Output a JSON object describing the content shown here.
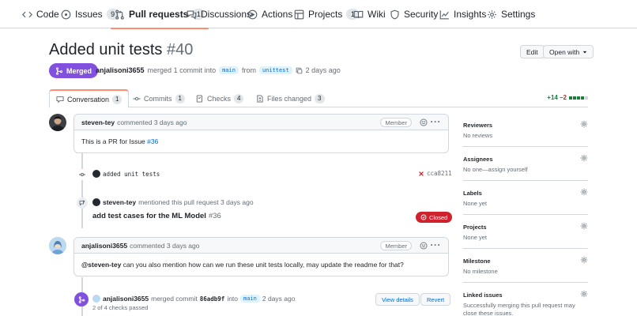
{
  "repo_nav": {
    "tabs": [
      {
        "label": "Code",
        "icon": "code-icon"
      },
      {
        "label": "Issues",
        "count": "9",
        "icon": "issue-opened-icon"
      },
      {
        "label": "Pull requests",
        "count": "1",
        "icon": "git-pull-request-icon",
        "selected": true
      },
      {
        "label": "Discussions",
        "icon": "comment-discussion-icon"
      },
      {
        "label": "Actions",
        "icon": "play-icon"
      },
      {
        "label": "Projects",
        "count": "1",
        "icon": "table-icon"
      },
      {
        "label": "Wiki",
        "icon": "book-icon"
      },
      {
        "label": "Security",
        "icon": "shield-icon"
      },
      {
        "label": "Insights",
        "icon": "graph-icon"
      },
      {
        "label": "Settings",
        "icon": "gear-icon"
      }
    ]
  },
  "header": {
    "title": "Added unit tests",
    "number": "#40",
    "edit_label": "Edit",
    "open_with_label": "Open with",
    "state_label": "Merged",
    "author": "anjalisoni3655",
    "merged_text": "merged 1 commit into",
    "base_branch": "main",
    "from_text": "from",
    "head_branch": "unittest",
    "time": "2 days ago"
  },
  "pr_tabs": {
    "conversation": {
      "label": "Conversation",
      "count": "1"
    },
    "commits": {
      "label": "Commits",
      "count": "1"
    },
    "checks": {
      "label": "Checks",
      "count": "4"
    },
    "files": {
      "label": "Files changed",
      "count": "3"
    },
    "additions": "+14",
    "deletions": "−2"
  },
  "timeline": {
    "comment1": {
      "author": "steven-tey",
      "meta": "commented 3 days ago",
      "role": "Member",
      "body_prefix": "This is a PR for Issue ",
      "body_link": "#36"
    },
    "commit": {
      "message": "added unit tests",
      "status_icon": "x-icon",
      "sha": "cca8211"
    },
    "mention": {
      "author": "steven-tey",
      "text": "mentioned this pull request 3 days ago",
      "issue_title": "add test cases for the ML Model",
      "issue_number": "#36",
      "state_label": "Closed"
    },
    "comment2": {
      "author": "anjalisoni3655",
      "meta": "commented 3 days ago",
      "role": "Member",
      "body_mention": "@steven-tey",
      "body_text": " can you also mention how can we run these unit tests locally, may update the readme for that?"
    },
    "merge": {
      "author": "anjalisoni3655",
      "text": "merged commit",
      "sha": "86adb9f",
      "into_text": "into",
      "branch": "main",
      "time": "2 days ago",
      "checks": "2 of 4 checks passed",
      "view_details_label": "View details",
      "revert_label": "Revert"
    }
  },
  "sidebar": {
    "reviewers": {
      "title": "Reviewers",
      "value": "No reviews"
    },
    "assignees": {
      "title": "Assignees",
      "value": "No one—assign yourself"
    },
    "labels": {
      "title": "Labels",
      "value": "None yet"
    },
    "projects": {
      "title": "Projects",
      "value": "None yet"
    },
    "milestone": {
      "title": "Milestone",
      "value": "No milestone"
    },
    "linked": {
      "title": "Linked issues",
      "value": "Successfully merging this pull request may close these issues."
    }
  },
  "colors": {
    "merged": "#8250df",
    "closed": "#cf222e",
    "link": "#0969da",
    "addition": "#1a7f37",
    "deletion": "#cf222e",
    "selected_underline": "#fd8c73"
  }
}
